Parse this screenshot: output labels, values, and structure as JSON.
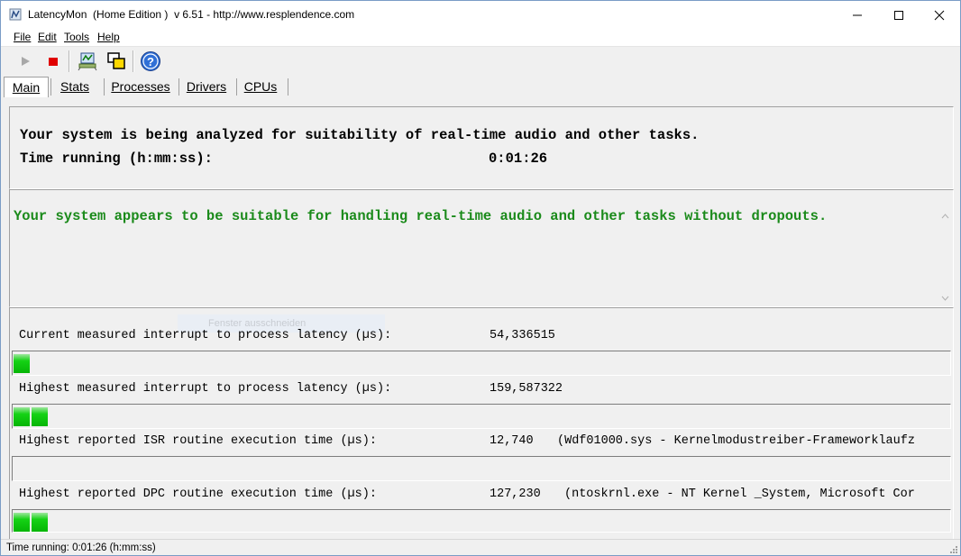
{
  "window": {
    "title": "LatencyMon  (Home Edition )  v 6.51 - http://www.resplendence.com",
    "controls": {
      "minimize": "—",
      "maximize": "☐",
      "close": "✕"
    }
  },
  "menu": [
    {
      "label": "File"
    },
    {
      "label": "Edit"
    },
    {
      "label": "Tools"
    },
    {
      "label": "Help"
    }
  ],
  "toolbar": {
    "buttons": [
      "play-icon",
      "stop-icon",
      "monitor-icon",
      "windows-icon",
      "help-icon"
    ],
    "help_glyph": "?"
  },
  "tabs": [
    {
      "label": "Main",
      "active": true
    },
    {
      "label": "Stats"
    },
    {
      "label": "Processes"
    },
    {
      "label": "Drivers"
    },
    {
      "label": "CPUs"
    }
  ],
  "main": {
    "analyzing_text": "Your system is being analyzed for suitability of real-time audio and other tasks.",
    "time_running_label": "Time running (h:mm:ss):",
    "time_running_value": "0:01:26",
    "verdict": "Your system appears to be suitable for handling real-time audio and other tasks without dropouts.",
    "ghost_tooltip": "Fenster ausschneiden"
  },
  "metrics": [
    {
      "label": "Current measured interrupt to process latency (µs):",
      "value": "54,336515",
      "detail": "",
      "bar_segments": 1
    },
    {
      "label": "Highest measured interrupt to process latency (µs):",
      "value": "159,587322",
      "detail": "",
      "bar_segments": 2
    },
    {
      "label": "Highest reported ISR routine execution time (µs):",
      "value": "12,740",
      "detail": "(Wdf01000.sys - Kernelmodustreiber-Frameworklaufz",
      "bar_segments": 0
    },
    {
      "label": "Highest reported DPC routine execution time (µs):",
      "value": "127,230",
      "detail": "(ntoskrnl.exe - NT Kernel _System, Microsoft Cor",
      "bar_segments": 2
    }
  ],
  "status": {
    "text": "Time running: 0:01:26  (h:mm:ss)"
  },
  "colors": {
    "verdict_green": "#1a8a1a",
    "bar_green": "#06b506",
    "stop_red": "#e00000"
  }
}
